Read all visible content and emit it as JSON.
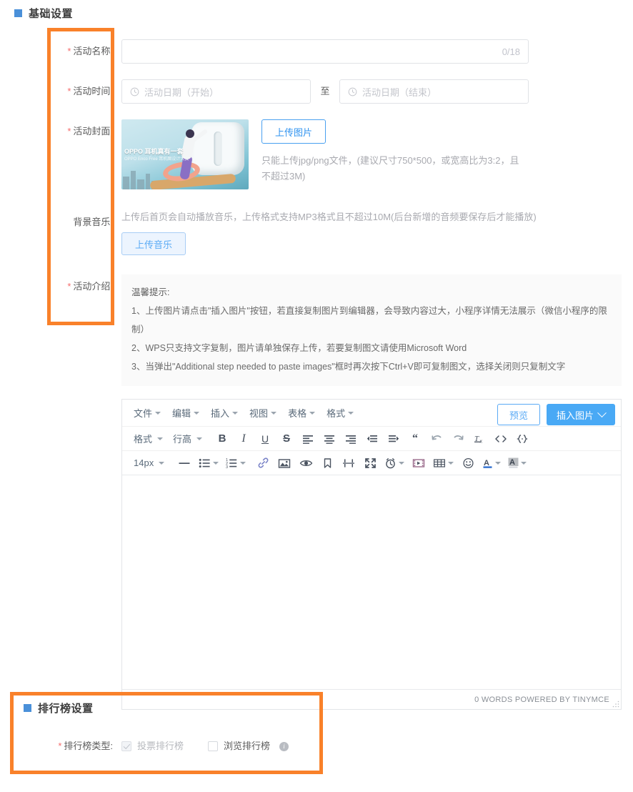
{
  "sections": {
    "basic": {
      "title": "基础设置"
    },
    "ranking": {
      "title": "排行榜设置"
    }
  },
  "form": {
    "activity_name": {
      "label": "活动名称:",
      "required": true,
      "value": "",
      "counter": "0/18"
    },
    "activity_time": {
      "label": "活动时间:",
      "required": true,
      "start_placeholder": "活动日期（开始）",
      "end_placeholder": "活动日期（结束）",
      "separator": "至"
    },
    "activity_cover": {
      "label": "活动封面:",
      "required": true,
      "upload_button": "上传图片",
      "hint": "只能上传jpg/png文件，(建议尺寸750*500，或宽高比为3:2，且不超过3M)",
      "thumbnail_title": "OPPO 耳机真有一套",
      "thumbnail_subtitle": "OPPO Enco Free 耳机图设计大赛"
    },
    "background_music": {
      "label": "背景音乐:",
      "required": false,
      "note": "上传后首页会自动播放音乐，上传格式支持MP3格式且不超过10M(后台新增的音频要保存后才能播放)",
      "upload_button": "上传音乐"
    },
    "activity_intro": {
      "label": "活动介绍:",
      "required": true
    }
  },
  "tips": {
    "title": "温馨提示:",
    "items": [
      "1、上传图片请点击\"插入图片\"按钮，若直接复制图片到编辑器，会导致内容过大，小程序详情无法展示（微信小程序的限制）",
      "2、WPS只支持文字复制，图片请单独保存上传，若要复制图文请使用Microsoft Word",
      "3、当弹出\"Additional step needed to paste images\"框时再次按下Ctrl+V即可复制图文，选择关闭则只复制文字"
    ]
  },
  "editor": {
    "menus": [
      "文件",
      "编辑",
      "插入",
      "视图",
      "表格",
      "格式"
    ],
    "preview_button": "预览",
    "insert_image_button": "插入图片",
    "row2": {
      "format_label": "格式",
      "lineheight_label": "行高",
      "bold": "B",
      "italic": "I",
      "underline": "U",
      "strikethrough": "S"
    },
    "row3": {
      "fontsize": "14px"
    },
    "status": "0 WORDS POWERED BY TINYMCE"
  },
  "ranking": {
    "type_label": "排行榜类型:",
    "required": true,
    "options": [
      {
        "label": "投票排行榜",
        "checked": true,
        "disabled": true,
        "has_info": false
      },
      {
        "label": "浏览排行榜",
        "checked": false,
        "disabled": false,
        "has_info": true
      }
    ]
  },
  "colors": {
    "annotation": "#f9812a",
    "section_marker": "#4a90d9",
    "primary": "#49a9f5",
    "required": "#f56c6c"
  }
}
